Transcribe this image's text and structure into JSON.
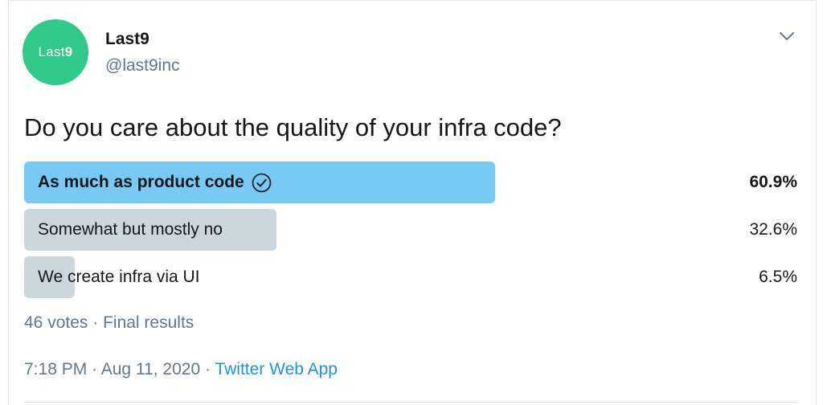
{
  "tweet": {
    "author": {
      "avatar_text_a": "Last",
      "avatar_text_b": "9",
      "display_name": "Last9",
      "handle": "@last9inc",
      "avatar_color": "#2fc98a"
    },
    "menu_icon": "chevron-down-icon",
    "question": "Do you care about the quality of your infra code?",
    "poll": {
      "options": [
        {
          "label": "As much as product code",
          "percent": "60.9%",
          "fraction": 0.609,
          "winner": true
        },
        {
          "label": "Somewhat but mostly no",
          "percent": "32.6%",
          "fraction": 0.326,
          "winner": false
        },
        {
          "label": "We create infra via UI",
          "percent": "6.5%",
          "fraction": 0.065,
          "winner": false
        }
      ],
      "winner_color": "#78c9f6",
      "other_color": "#ccd6dd",
      "votes": "46 votes",
      "separator": "·",
      "status": "Final results"
    },
    "time": "7:18 PM",
    "date": "Aug 11, 2020",
    "source": "Twitter Web App",
    "link_color": "#1b95e0"
  }
}
